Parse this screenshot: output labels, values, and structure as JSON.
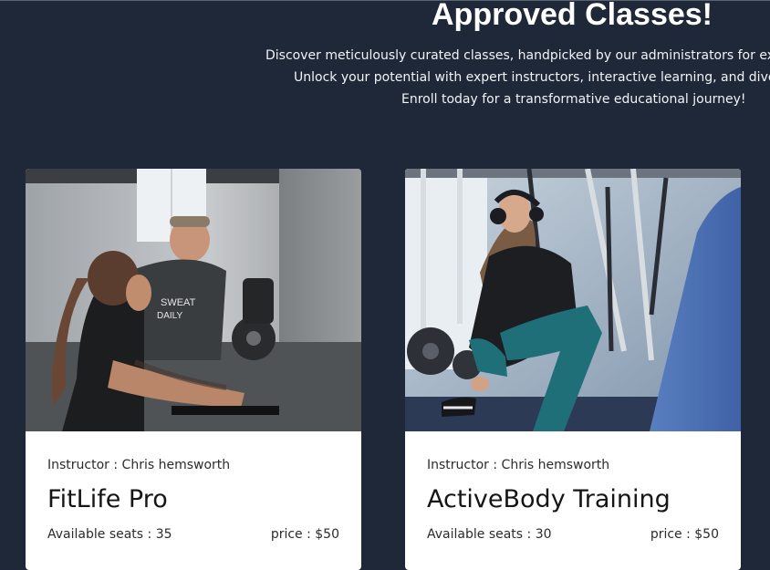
{
  "hero": {
    "title": "Approved Classes!",
    "line1": "Discover meticulously curated classes, handpicked by our administrators for ex",
    "line2": "Unlock your potential with expert instructors, interactive learning, and dive",
    "line3": "Enroll today for a transformative educational journey!"
  },
  "classes": [
    {
      "instructor": "Instructor : Chris hemsworth",
      "name": "FitLife Pro",
      "seats": "Available seats : 35",
      "price": "price : $50",
      "image": "gym-rowing-photo"
    },
    {
      "instructor": "Instructor : Chris hemsworth",
      "name": "ActiveBody Training",
      "seats": "Available seats : 30",
      "price": "price : $50",
      "image": "gym-stretching-photo"
    }
  ]
}
